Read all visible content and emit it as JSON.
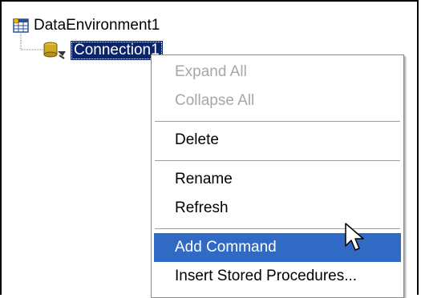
{
  "tree": {
    "root_label": "DataEnvironment1",
    "root_icon": "data-environment-icon",
    "child_label": "Connection1",
    "child_icon": "database-connection-icon"
  },
  "context_menu": {
    "items": [
      {
        "label": "Expand All",
        "enabled": false
      },
      {
        "label": "Collapse All",
        "enabled": false
      },
      {
        "label": "Delete",
        "enabled": true
      },
      {
        "label": "Rename",
        "enabled": true
      },
      {
        "label": "Refresh",
        "enabled": true
      },
      {
        "label": "Add Command",
        "enabled": true,
        "highlighted": true
      },
      {
        "label": "Insert Stored Procedures...",
        "enabled": true
      }
    ]
  },
  "colors": {
    "selection": "#0a246a",
    "menu_highlight": "#316ac5",
    "disabled_text": "#a7a6aa"
  }
}
